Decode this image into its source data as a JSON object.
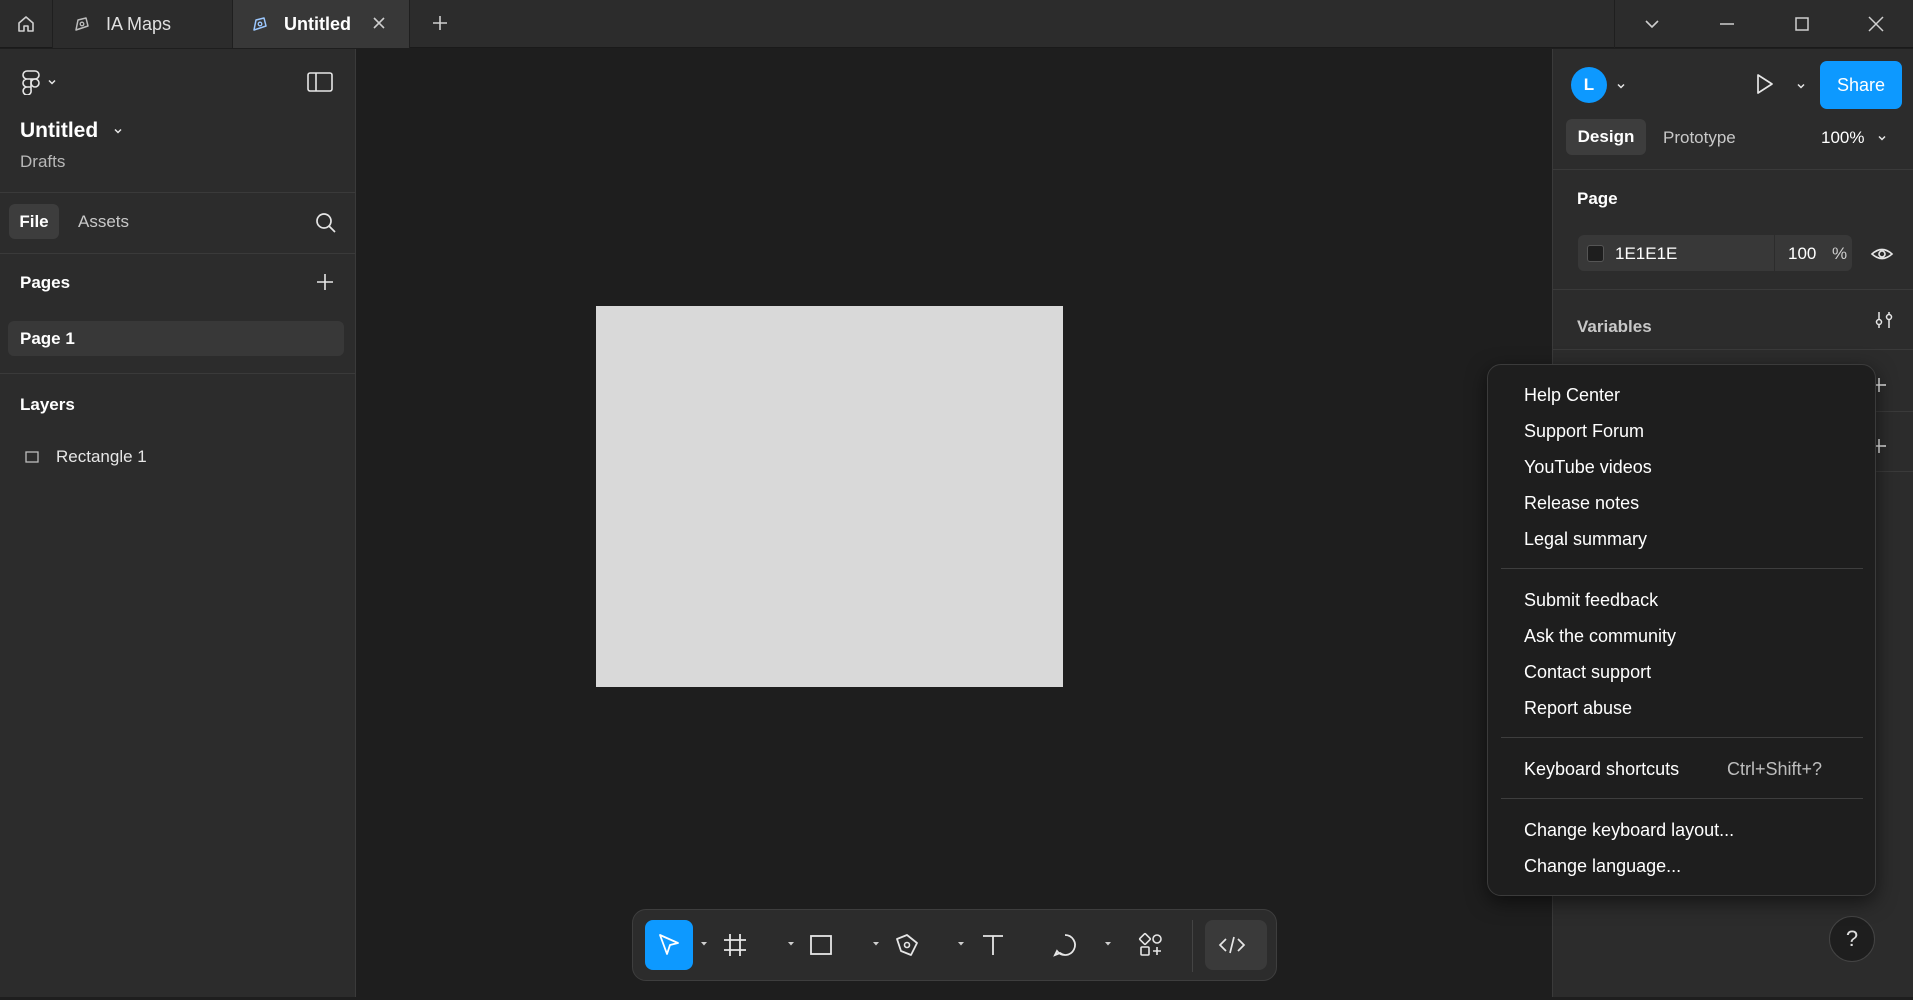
{
  "titlebar": {
    "tabs": [
      {
        "label": "IA Maps"
      },
      {
        "label": "Untitled"
      }
    ]
  },
  "left_panel": {
    "file_title": "Untitled",
    "file_location": "Drafts",
    "tabs": [
      "File",
      "Assets"
    ],
    "pages_heading": "Pages",
    "pages": [
      "Page 1"
    ],
    "layers_heading": "Layers",
    "layers": [
      "Rectangle 1"
    ]
  },
  "canvas": {
    "rectangle_color": "#D9D9D9",
    "background_color": "#1E1E1E"
  },
  "toolbar": {
    "active_tool": "move",
    "tools": [
      "move-icon",
      "frame-icon",
      "rectangle-icon",
      "pen-icon",
      "text-icon",
      "comment-icon",
      "actions-icon",
      "dev-mode-icon"
    ]
  },
  "right_panel": {
    "avatar_initial": "L",
    "share_label": "Share",
    "tabs": [
      "Design",
      "Prototype"
    ],
    "zoom": "100%",
    "page_heading": "Page",
    "page_color_hex": "1E1E1E",
    "page_opacity": "100",
    "page_opacity_unit": "%",
    "variables_heading": "Variables",
    "help_label": "?"
  },
  "help_menu": {
    "group1": [
      "Help Center",
      "Support Forum",
      "YouTube videos",
      "Release notes",
      "Legal summary"
    ],
    "group2": [
      "Submit feedback",
      "Ask the community",
      "Contact support",
      "Report abuse"
    ],
    "shortcuts_label": "Keyboard shortcuts",
    "shortcuts_key": "Ctrl+Shift+?",
    "group4": [
      "Change keyboard layout...",
      "Change language..."
    ]
  },
  "colors": {
    "accent": "#0D99FF",
    "panel": "#2C2C2C",
    "canvas": "#1E1E1E"
  }
}
